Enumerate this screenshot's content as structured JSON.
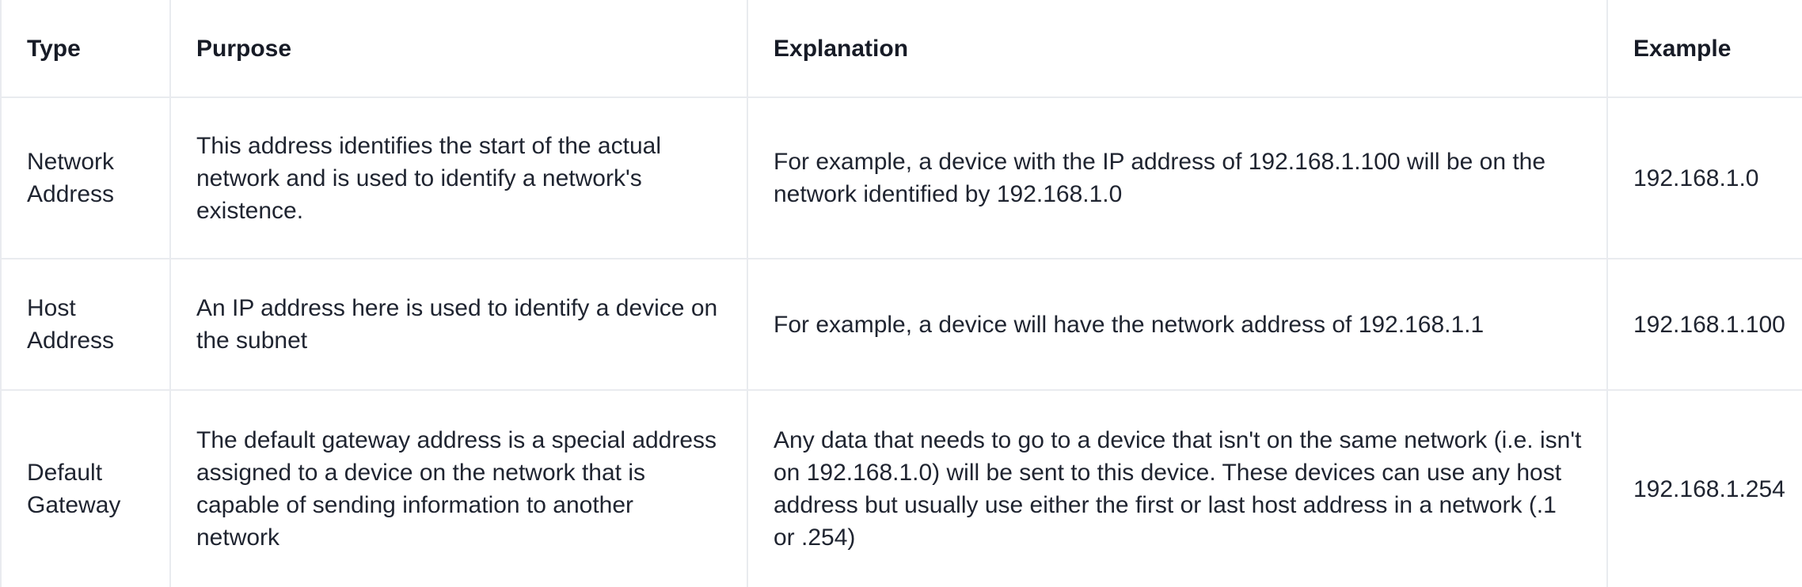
{
  "table": {
    "headers": [
      "Type",
      "Purpose",
      "Explanation",
      "Example"
    ],
    "rows": [
      {
        "type": "Network Address",
        "purpose": "This address identifies the start of the actual network and is used to identify a network's existence.",
        "explanation": "For example, a device with the IP address of 192.168.1.100 will be on the network identified by 192.168.1.0",
        "example": "192.168.1.0"
      },
      {
        "type": "Host Address",
        "purpose": "An IP address here is used to identify a device on the subnet",
        "explanation": "For example, a device will have the network address of 192.168.1.1",
        "example": "192.168.1.100"
      },
      {
        "type": "Default Gateway",
        "purpose": "The default gateway address is a special address assigned to a device on the network that is capable of sending information to another network",
        "explanation": "Any data that needs to go to a device that isn't on the same network (i.e. isn't on 192.168.1.0) will be sent to this device. These devices can use any host address but usually use either the first or last host address in a network (.1 or .254)",
        "example": "192.168.1.254"
      }
    ]
  }
}
